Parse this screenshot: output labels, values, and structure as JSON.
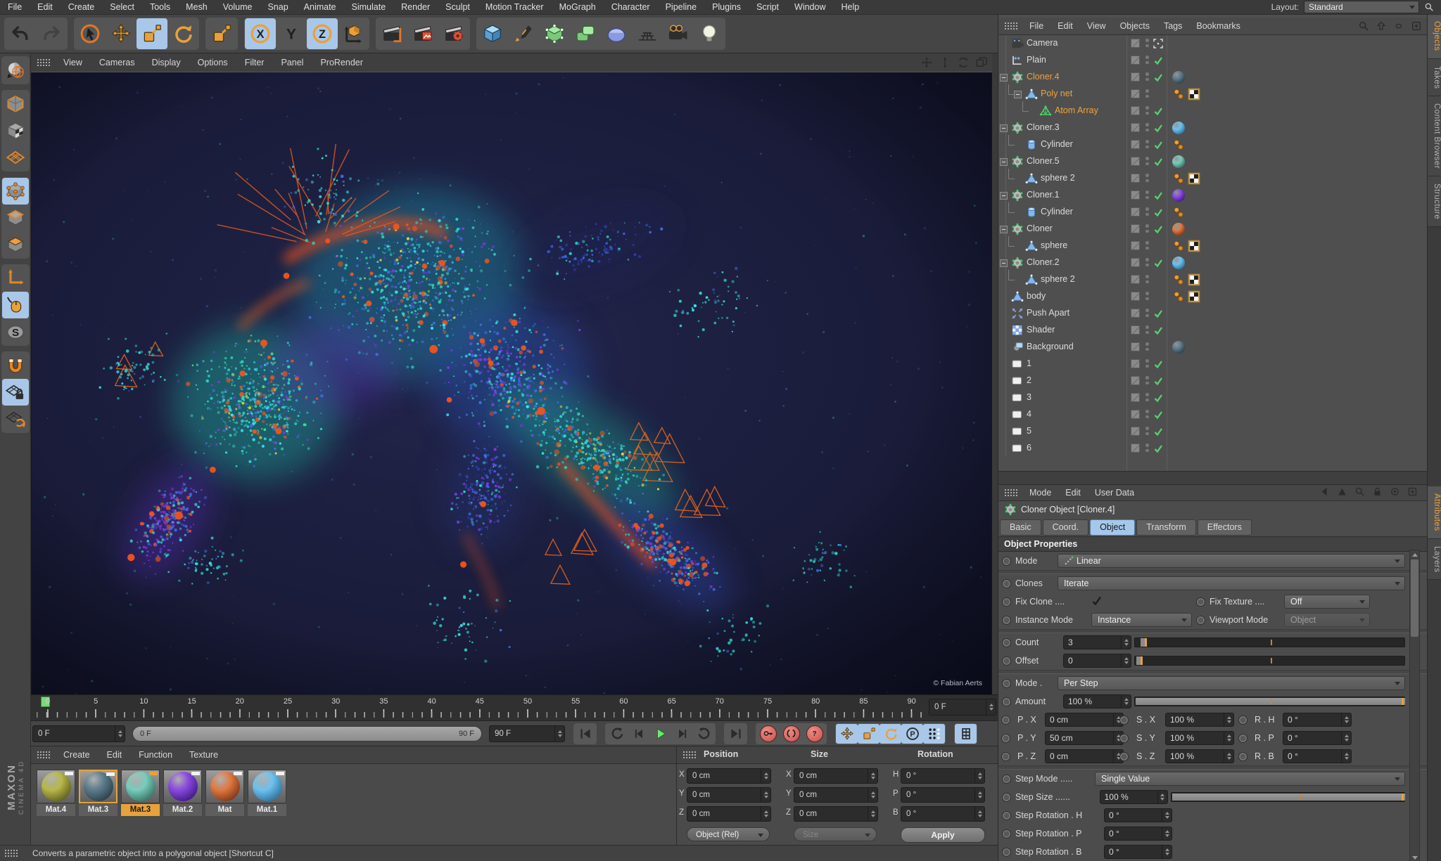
{
  "menubar": {
    "items": [
      "File",
      "Edit",
      "Create",
      "Select",
      "Tools",
      "Mesh",
      "Volume",
      "Snap",
      "Animate",
      "Simulate",
      "Render",
      "Sculpt",
      "Motion Tracker",
      "MoGraph",
      "Character",
      "Pipeline",
      "Plugins",
      "Script",
      "Window",
      "Help"
    ],
    "layout_label": "Layout:",
    "layout_value": "Standard"
  },
  "toolbar": {
    "groups": [
      {
        "buttons": [
          {
            "name": "undo-button",
            "icon": "undo"
          },
          {
            "name": "redo-button",
            "icon": "redo",
            "dim": true
          }
        ]
      },
      {
        "buttons": [
          {
            "name": "live-selection-tool",
            "icon": "live"
          },
          {
            "name": "move-tool",
            "icon": "move"
          },
          {
            "name": "scale-tool",
            "icon": "scale",
            "active": true
          },
          {
            "name": "rotate-tool",
            "icon": "rotate"
          }
        ]
      },
      {
        "buttons": [
          {
            "name": "last-used-tool",
            "icon": "scale"
          }
        ]
      },
      {
        "buttons": [
          {
            "name": "lock-x-axis",
            "icon": "lockx",
            "active": true
          },
          {
            "name": "lock-y-axis",
            "icon": "locky"
          },
          {
            "name": "lock-z-axis",
            "icon": "lockz",
            "active": true
          },
          {
            "name": "coordinate-system",
            "icon": "coord"
          }
        ]
      },
      {
        "buttons": [
          {
            "name": "render-view-button",
            "icon": "renderview"
          },
          {
            "name": "render-picture-viewer-button",
            "icon": "renderpv"
          },
          {
            "name": "render-settings-button",
            "icon": "rendersettings"
          }
        ]
      },
      {
        "buttons": [
          {
            "name": "add-cube-object",
            "icon": "cube"
          },
          {
            "name": "spline-pen-tool",
            "icon": "pen"
          },
          {
            "name": "subdivision-surface-object",
            "icon": "sds"
          },
          {
            "name": "mograph-cloner-object",
            "icon": "clones"
          },
          {
            "name": "deformer-object",
            "icon": "deform"
          },
          {
            "name": "floor-object",
            "icon": "floor"
          },
          {
            "name": "camera-object",
            "icon": "cam"
          },
          {
            "name": "light-object",
            "icon": "light"
          }
        ]
      }
    ]
  },
  "left_toolbar": {
    "groups": [
      {
        "buttons": [
          {
            "name": "make-editable",
            "icon": "editable"
          }
        ]
      },
      {
        "buttons": [
          {
            "name": "model-mode",
            "icon": "modelmode"
          },
          {
            "name": "texture-mode",
            "icon": "texmode"
          },
          {
            "name": "workplane-mode",
            "icon": "wpmode"
          }
        ]
      },
      {
        "buttons": [
          {
            "name": "points-mode",
            "icon": "points",
            "active": true
          },
          {
            "name": "edges-mode",
            "icon": "edges"
          },
          {
            "name": "polygons-mode",
            "icon": "polys"
          }
        ]
      },
      {
        "buttons": [
          {
            "name": "enable-axis-mode",
            "icon": "axismode"
          },
          {
            "name": "tweak-mode",
            "icon": "tweak",
            "active": true
          },
          {
            "name": "soft-selection",
            "icon": "softsel"
          }
        ]
      },
      {
        "buttons": [
          {
            "name": "snap-settings",
            "icon": "magnet"
          },
          {
            "name": "workplane-lock",
            "icon": "wplock",
            "active": true
          },
          {
            "name": "quantize-settings",
            "icon": "wprotate"
          }
        ]
      }
    ]
  },
  "viewport": {
    "menu": [
      "View",
      "Cameras",
      "Display",
      "Options",
      "Filter",
      "Panel",
      "ProRender"
    ],
    "corner_icons": [
      "pan",
      "dolly",
      "orbit",
      "maximize"
    ],
    "credit": "© Fabian Aerts"
  },
  "object_manager": {
    "menu": [
      "File",
      "Edit",
      "View",
      "Objects",
      "Tags",
      "Bookmarks"
    ],
    "header_icons": [
      "search",
      "home",
      "oval",
      "add"
    ],
    "side_tabs": [
      {
        "label": "Objects",
        "active": true
      },
      {
        "label": "Takes"
      },
      {
        "label": "Content Browser"
      },
      {
        "label": "Structure"
      }
    ],
    "rows": [
      {
        "label": "Camera",
        "icon": "camera",
        "depth": 0,
        "state": "target",
        "tags": []
      },
      {
        "label": "Plain",
        "icon": "plain",
        "depth": 0,
        "state": "check",
        "tags": []
      },
      {
        "label": "Cloner.4",
        "icon": "cloner",
        "depth": 0,
        "expand": true,
        "selected": true,
        "state": "check",
        "tags": [
          {
            "t": "sphere",
            "c1": "#5d7c8c",
            "c2": "#1e3038"
          }
        ]
      },
      {
        "label": "Poly net",
        "icon": "poly",
        "depth": 1,
        "expand": true,
        "selected": true,
        "state": "none",
        "tags": [
          {
            "t": "phong"
          },
          {
            "t": "uvw"
          }
        ]
      },
      {
        "label": "Atom Array",
        "icon": "atom",
        "depth": 2,
        "selected": true,
        "state": "check",
        "tags": []
      },
      {
        "label": "Cloner.3",
        "icon": "cloner",
        "depth": 0,
        "expand": true,
        "state": "check",
        "tags": [
          {
            "t": "sphere",
            "c1": "#6ec2ee",
            "c2": "#1e5e8a"
          }
        ]
      },
      {
        "label": "Cylinder",
        "icon": "cylinder",
        "depth": 1,
        "state": "check",
        "tags": [
          {
            "t": "phong"
          }
        ]
      },
      {
        "label": "Cloner.5",
        "icon": "cloner",
        "depth": 0,
        "expand": true,
        "state": "check",
        "tags": [
          {
            "t": "sphere",
            "c1": "#7accbc",
            "c2": "#265e50"
          }
        ]
      },
      {
        "label": "sphere 2",
        "icon": "poly",
        "depth": 1,
        "state": "none",
        "tags": [
          {
            "t": "phong"
          },
          {
            "t": "uvw"
          }
        ]
      },
      {
        "label": "Cloner.1",
        "icon": "cloner",
        "depth": 0,
        "expand": true,
        "state": "check",
        "tags": [
          {
            "t": "sphere",
            "c1": "#8a4ae0",
            "c2": "#2e0e6a"
          }
        ]
      },
      {
        "label": "Cylinder",
        "icon": "cylinder",
        "depth": 1,
        "state": "check",
        "tags": [
          {
            "t": "phong"
          }
        ]
      },
      {
        "label": "Cloner",
        "icon": "cloner",
        "depth": 0,
        "expand": true,
        "state": "check",
        "tags": [
          {
            "t": "sphere",
            "c1": "#e07a42",
            "c2": "#6a240c"
          }
        ]
      },
      {
        "label": "sphere",
        "icon": "poly",
        "depth": 1,
        "state": "none",
        "tags": [
          {
            "t": "phong"
          },
          {
            "t": "uvw"
          }
        ]
      },
      {
        "label": "Cloner.2",
        "icon": "cloner",
        "depth": 0,
        "expand": true,
        "state": "check",
        "tags": [
          {
            "t": "sphere",
            "c1": "#6ec2ee",
            "c2": "#1e5e8a"
          }
        ]
      },
      {
        "label": "sphere 2",
        "icon": "poly",
        "depth": 1,
        "state": "none",
        "tags": [
          {
            "t": "phong"
          },
          {
            "t": "uvw"
          }
        ]
      },
      {
        "label": "body",
        "icon": "poly",
        "depth": 0,
        "state": "none",
        "tags": [
          {
            "t": "phong"
          },
          {
            "t": "uvw"
          }
        ]
      },
      {
        "label": "Push Apart",
        "icon": "push",
        "depth": 0,
        "state": "check",
        "tags": []
      },
      {
        "label": "Shader",
        "icon": "shader",
        "depth": 0,
        "state": "check",
        "tags": []
      },
      {
        "label": "Background",
        "icon": "background",
        "depth": 0,
        "state": "none",
        "tags": [
          {
            "t": "sphere",
            "c1": "#5d7c8c",
            "c2": "#1e3038"
          }
        ]
      },
      {
        "label": "1",
        "icon": "layer",
        "depth": 0,
        "state": "check",
        "tags": []
      },
      {
        "label": "2",
        "icon": "layer",
        "depth": 0,
        "state": "check",
        "tags": []
      },
      {
        "label": "3",
        "icon": "layer",
        "depth": 0,
        "state": "check",
        "tags": []
      },
      {
        "label": "4",
        "icon": "layer",
        "depth": 0,
        "state": "check",
        "tags": []
      },
      {
        "label": "5",
        "icon": "layer",
        "depth": 0,
        "state": "check",
        "tags": []
      },
      {
        "label": "6",
        "icon": "layer",
        "depth": 0,
        "state": "check",
        "tags": []
      }
    ]
  },
  "attributes": {
    "menu": [
      "Mode",
      "Edit",
      "User Data"
    ],
    "header_icons": [
      "back",
      "forward",
      "search",
      "lock",
      "focus",
      "add"
    ],
    "title": "Cloner Object [Cloner.4]",
    "tabs": [
      {
        "label": "Basic"
      },
      {
        "label": "Coord."
      },
      {
        "label": "Object",
        "active": true
      },
      {
        "label": "Transform"
      },
      {
        "label": "Effectors"
      }
    ],
    "section": "Object Properties",
    "side_tabs": [
      {
        "label": "Attributes",
        "active": true
      },
      {
        "label": "Layers"
      }
    ],
    "rows": [
      {
        "type": "dropdown",
        "label": "Mode",
        "value": "Linear",
        "icon": "linear"
      },
      {
        "type": "sep"
      },
      {
        "type": "dropdown",
        "label": "Clones",
        "value": "Iterate"
      },
      {
        "type": "dual",
        "left": {
          "label": "Fix Clone ....",
          "control": "check"
        },
        "right": {
          "label": "Fix Texture ....",
          "control": "dropdown",
          "value": "Off"
        }
      },
      {
        "type": "dual",
        "left": {
          "label": "Instance Mode",
          "control": "dropdown",
          "value": "Instance"
        },
        "right": {
          "label": "Viewport Mode",
          "control": "dropdown",
          "value": "Object",
          "disabled": true
        }
      },
      {
        "type": "sep"
      },
      {
        "type": "slider",
        "label": "Count",
        "value": "3",
        "fill": 0.02,
        "tick": 0.5
      },
      {
        "type": "slider",
        "label": "Offset",
        "value": "0",
        "fill": 0.005,
        "tick": 0.5
      },
      {
        "type": "sep"
      },
      {
        "type": "dropdown",
        "label": "Mode .",
        "value": "Per Step"
      },
      {
        "type": "slider",
        "label": "Amount",
        "value": "100 %",
        "fill": 1,
        "tick": 0.5
      },
      {
        "type": "triple",
        "cells": [
          [
            "P . X",
            "0 cm"
          ],
          [
            "S . X",
            "100 %"
          ],
          [
            "R . H",
            "0 °"
          ]
        ]
      },
      {
        "type": "triple",
        "cells": [
          [
            "P . Y",
            "50 cm"
          ],
          [
            "S . Y",
            "100 %"
          ],
          [
            "R . P",
            "0 °"
          ]
        ]
      },
      {
        "type": "triple",
        "cells": [
          [
            "P . Z",
            "0 cm"
          ],
          [
            "S . Z",
            "100 %"
          ],
          [
            "R . B",
            "0 °"
          ]
        ]
      },
      {
        "type": "sep"
      },
      {
        "type": "dropdown",
        "label": "Step Mode .....",
        "value": "Single Value"
      },
      {
        "type": "slider",
        "label": "Step Size ......",
        "value": "100 %",
        "fill": 1,
        "tick": 0.55
      },
      {
        "type": "spinner",
        "label": "Step Rotation . H",
        "value": "0 °"
      },
      {
        "type": "spinner",
        "label": "Step Rotation . P",
        "value": "0 °"
      },
      {
        "type": "spinner",
        "label": "Step Rotation . B",
        "value": "0 °"
      }
    ]
  },
  "timeline": {
    "ticks": [
      "0",
      "5",
      "10",
      "15",
      "20",
      "25",
      "30",
      "35",
      "40",
      "45",
      "50",
      "55",
      "60",
      "65",
      "70",
      "75",
      "80",
      "85",
      "90"
    ],
    "ruler_frame": "0 F",
    "current_frame": "0 F",
    "range_start": "0 F",
    "range_end": "90 F",
    "end_frame": "90 F"
  },
  "transport": {
    "groups": [
      {
        "buttons": [
          {
            "name": "goto-start-button",
            "icon": "skipstart"
          }
        ]
      },
      {
        "buttons": [
          {
            "name": "goto-previous-key-button",
            "icon": "arcleft"
          },
          {
            "name": "previous-frame-button",
            "icon": "stepleft"
          },
          {
            "name": "play-button",
            "icon": "play"
          },
          {
            "name": "next-frame-button",
            "icon": "stepright"
          },
          {
            "name": "goto-next-key-button",
            "icon": "arcright"
          }
        ]
      },
      {
        "buttons": [
          {
            "name": "goto-end-button",
            "icon": "skipend"
          }
        ]
      },
      {
        "buttons": [
          {
            "name": "record-keyframe-button",
            "icon": "key",
            "style": "red"
          },
          {
            "name": "autokeying-button",
            "icon": "autokey",
            "style": "red"
          },
          {
            "name": "keyframe-help-button",
            "icon": "question",
            "style": "red"
          }
        ]
      },
      {
        "buttons": [
          {
            "name": "key-position-toggle",
            "icon": "move",
            "style": "blue"
          },
          {
            "name": "key-scale-toggle",
            "icon": "scale",
            "style": "blue"
          },
          {
            "name": "key-rotation-toggle",
            "icon": "rotate",
            "style": "blue"
          },
          {
            "name": "key-parameter-toggle",
            "icon": "param",
            "style": "blue"
          },
          {
            "name": "key-pla-toggle",
            "icon": "pla",
            "style": "blue"
          }
        ]
      },
      {
        "buttons": [
          {
            "name": "keyframe-selection-button",
            "icon": "film",
            "style": "blue"
          }
        ]
      }
    ]
  },
  "materials": {
    "menu": [
      "Create",
      "Edit",
      "Function",
      "Texture"
    ],
    "items": [
      {
        "name": "Mat.4",
        "top": "#b8b84a",
        "bottom": "#4a4a12"
      },
      {
        "name": "Mat.3",
        "top": "#5d7c8c",
        "bottom": "#1e3038",
        "outlined": true
      },
      {
        "name": "Mat.3",
        "top": "#7accbc",
        "bottom": "#265e50",
        "active": true
      },
      {
        "name": "Mat.2",
        "top": "#8a4ae0",
        "bottom": "#2e0e6a"
      },
      {
        "name": "Mat",
        "top": "#e07a42",
        "bottom": "#6a240c"
      },
      {
        "name": "Mat.1",
        "top": "#6ec2ee",
        "bottom": "#1e5e8a"
      }
    ]
  },
  "coordinates": {
    "groups": [
      {
        "title": "Position",
        "axes": [
          "X",
          "Y",
          "Z"
        ],
        "values": [
          "0 cm",
          "0 cm",
          "0 cm"
        ]
      },
      {
        "title": "Size",
        "axes": [
          "X",
          "Y",
          "Z"
        ],
        "values": [
          "0 cm",
          "0 cm",
          "0 cm"
        ]
      },
      {
        "title": "Rotation",
        "axes": [
          "H",
          "P",
          "B"
        ],
        "values": [
          "0 °",
          "0 °",
          "0 °"
        ]
      }
    ],
    "footer": {
      "space": "Object (Rel)",
      "size_mode": "Size",
      "apply": "Apply"
    }
  },
  "status_bar": {
    "text": "Converts a parametric object into a polygonal object [Shortcut C]"
  },
  "branding": {
    "line1": "MAXON",
    "line2": "CINEMA 4D"
  },
  "accent_colors": {
    "selection_orange": "#f0a43c",
    "check_green": "#5ad072",
    "active_blue": "#a9c7e9",
    "viewport_navy": "#15172e"
  }
}
